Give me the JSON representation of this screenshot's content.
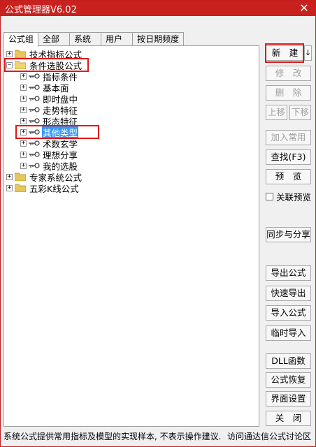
{
  "window": {
    "title": "公式管理器V6.02",
    "close_glyph": "✕",
    "accent_color": "#c9211e"
  },
  "tabs": [
    {
      "label": "公式组",
      "active": true
    },
    {
      "label": "全部"
    },
    {
      "label": "系统"
    },
    {
      "label": "用户"
    },
    {
      "label": "按日期频度"
    }
  ],
  "tree": {
    "groups": [
      {
        "label": "技术指标公式",
        "expanded": false
      },
      {
        "label": "条件选股公式",
        "expanded": true,
        "children": [
          "指标条件",
          "基本面",
          "即时盘中",
          "走势特征",
          "形态特征",
          "其他类型",
          "术数玄学",
          "理想分享",
          "我的选股"
        ],
        "selected_child": "其他类型"
      },
      {
        "label": "专家系统公式",
        "expanded": false
      },
      {
        "label": "五彩K线公式",
        "expanded": false
      }
    ]
  },
  "buttons": {
    "new": "新　建",
    "new_dropdown_glyph": "↓",
    "modify": "修　改",
    "delete": "删　除",
    "move_up": "上移",
    "move_down": "下移",
    "add_common": "加入常用",
    "find": "查找(F3)",
    "preview": "预　览",
    "link_preview": "关联预览",
    "sync_share": "同步与分享",
    "export": "导出公式",
    "quick_export": "快速导出",
    "import": "导入公式",
    "temp_import": "临时导入",
    "dll": "DLL函数",
    "restore": "公式恢复",
    "ui_settings": "界面设置",
    "close": "关　闭"
  },
  "status": {
    "left": "系统公式提供常用指标及模型的实现样本, 不表示操作建议.",
    "right": "访问通达信公式讨论区"
  }
}
